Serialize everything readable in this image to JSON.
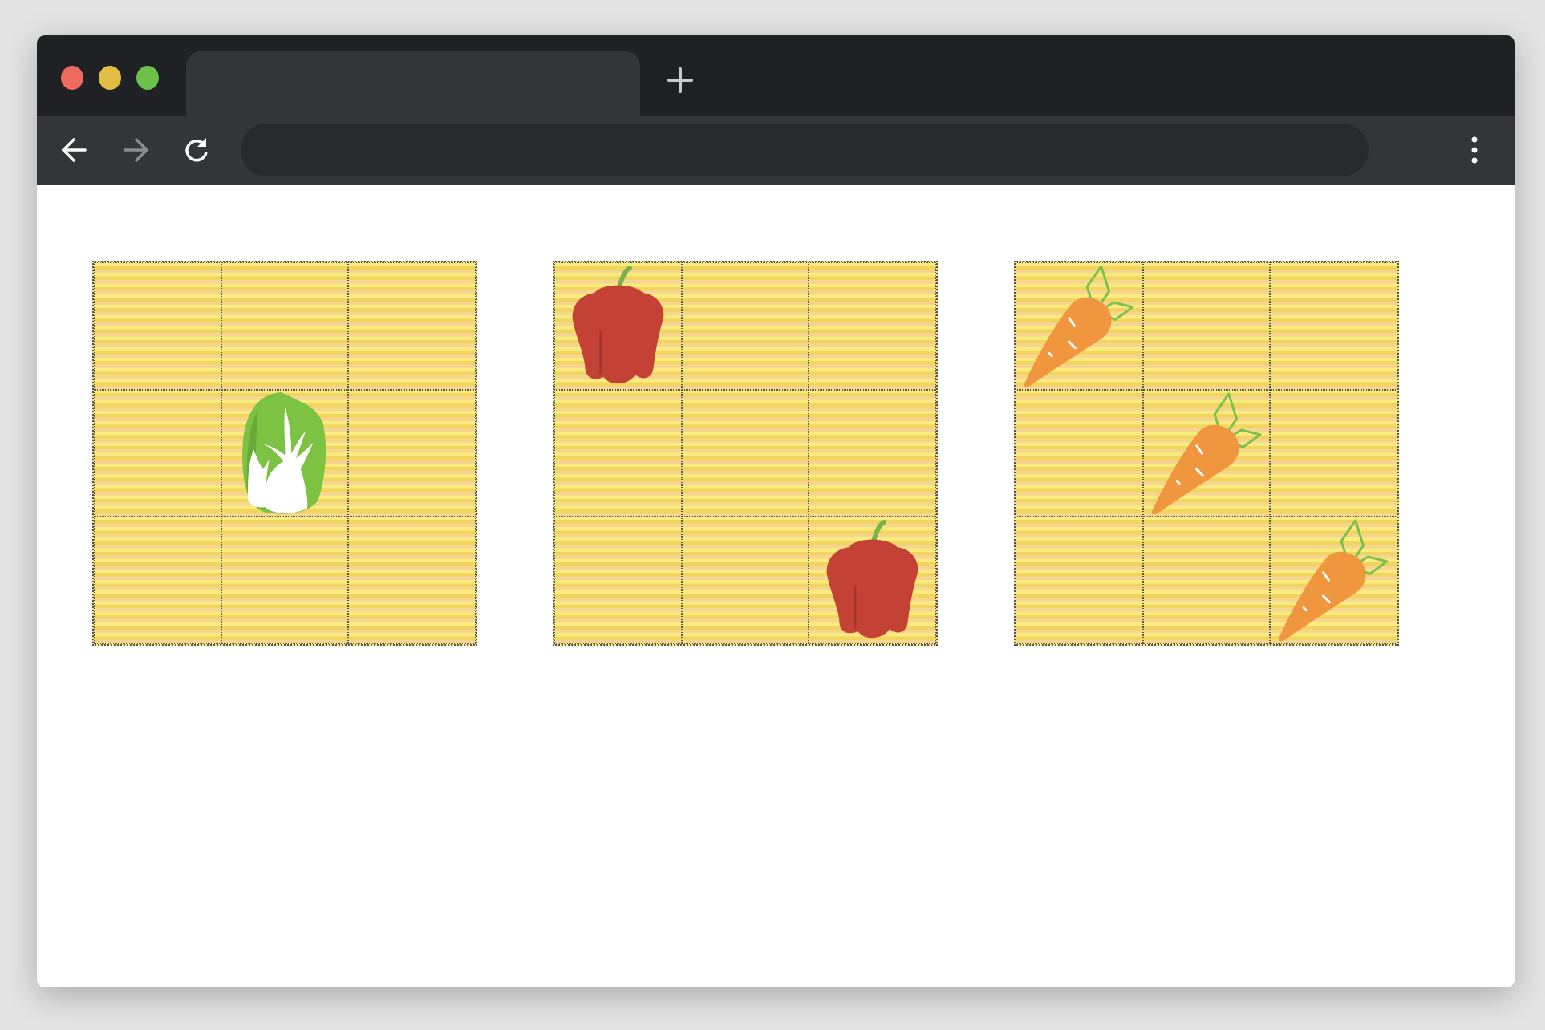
{
  "browser": {
    "traffic_lights": {
      "close": "#ee6a5e",
      "minimize": "#e1bf47",
      "maximize": "#6cc14b"
    },
    "icons": [
      "back-arrow-icon",
      "forward-arrow-icon",
      "reload-icon",
      "new-tab-plus-icon",
      "more-vert-icon"
    ]
  },
  "colors": {
    "stripe_light": "#f8ec7e",
    "stripe_gold": "#f2d45e",
    "stripe_peach": "#f6d590",
    "grid_line": "#555555"
  },
  "grids": [
    {
      "name": "cabbage-grid",
      "items": [
        {
          "type": "cabbage",
          "row": 1,
          "col": 1
        }
      ]
    },
    {
      "name": "pepper-grid",
      "items": [
        {
          "type": "pepper",
          "row": 0,
          "col": 0
        },
        {
          "type": "pepper",
          "row": 2,
          "col": 2
        }
      ]
    },
    {
      "name": "carrot-grid",
      "items": [
        {
          "type": "carrot",
          "row": 0,
          "col": 0
        },
        {
          "type": "carrot",
          "row": 1,
          "col": 1
        },
        {
          "type": "carrot",
          "row": 2,
          "col": 2
        }
      ]
    }
  ]
}
